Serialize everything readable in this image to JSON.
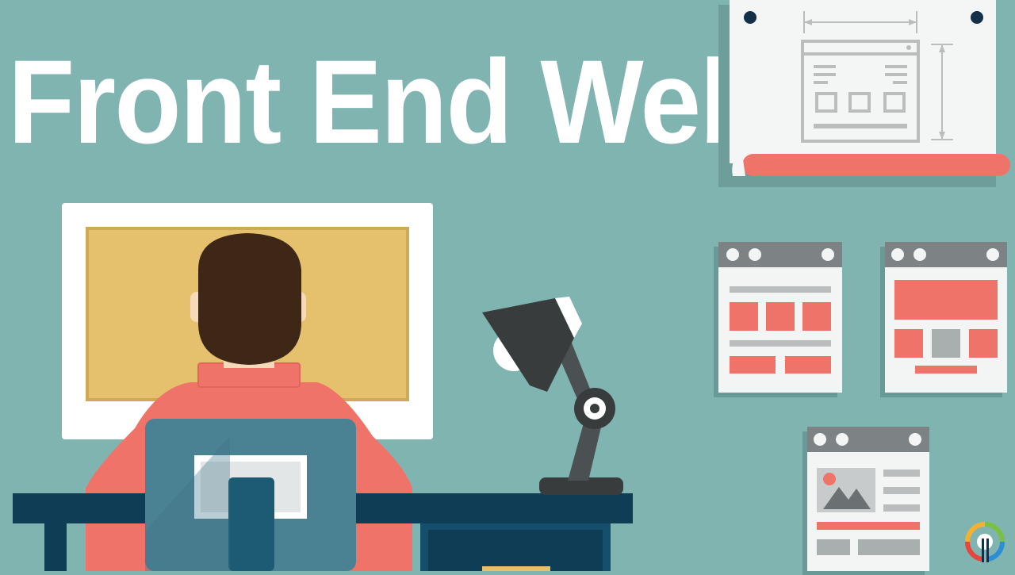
{
  "title": "Front End Web",
  "colors": {
    "background": "#80b4b0",
    "accent_red": "#f07369",
    "monitor_screen": "#e6c16d",
    "hair": "#3f2718",
    "desk": "#0f3d56",
    "chair": "#4a8193",
    "lamp": "#383c3d",
    "wireframe_gray": "#a9aeaf"
  },
  "icons": {
    "logo": "channel-logo-icon",
    "lamp": "desk-lamp-icon"
  }
}
